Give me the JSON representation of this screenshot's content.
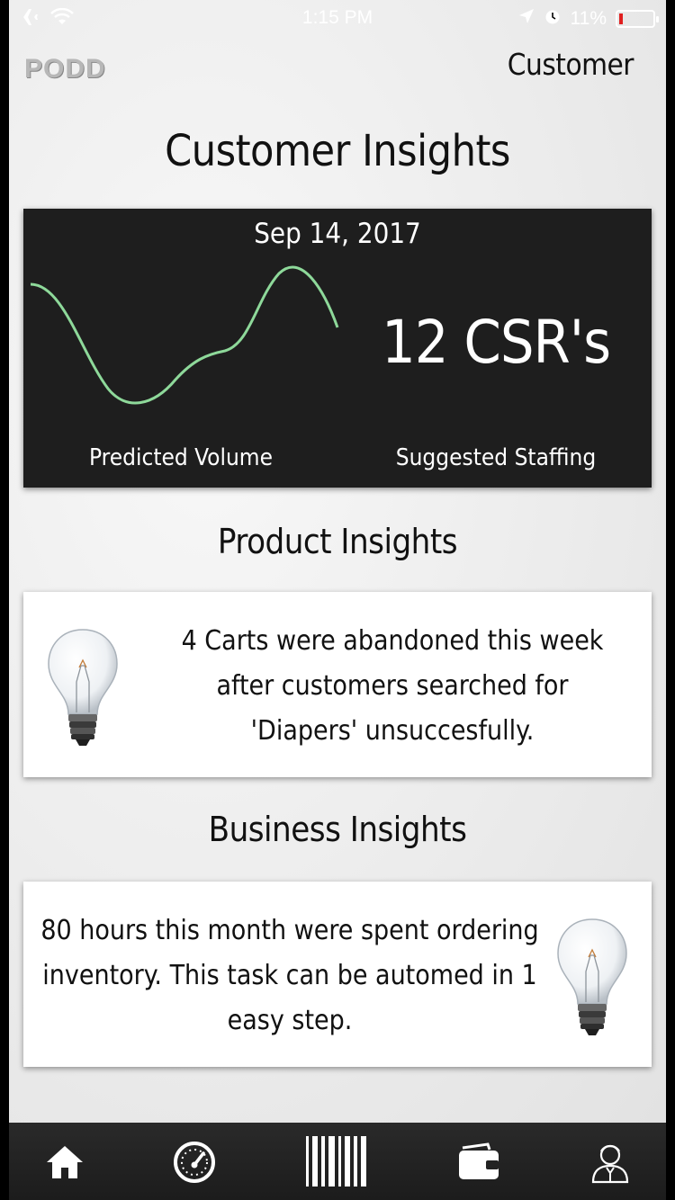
{
  "status_bar": {
    "time": "1:15 PM",
    "battery_percent": "11%",
    "battery_level": 0.11,
    "icons": [
      "airplane-icon",
      "wifi-icon",
      "location-icon",
      "alarm-icon",
      "battery-icon"
    ]
  },
  "header": {
    "logo": "PODD",
    "nav_link": "Customer"
  },
  "customer_insights": {
    "title": "Customer Insights",
    "date": "Sep 14, 2017",
    "staffing_value": "12 CSR's",
    "volume_label": "Predicted Volume",
    "staffing_label": "Suggested Staffing",
    "line_color": "#8ed99a"
  },
  "product_insights": {
    "title": "Product Insights",
    "text": "4 Carts were abandoned this week after customers searched for 'Diapers' unsuccesfully.",
    "icon": "lightbulb-icon"
  },
  "business_insights": {
    "title": "Business Insights",
    "text": "80 hours this month were spent ordering inventory. This task can be automed in 1 easy step.",
    "icon": "lightbulb-icon"
  },
  "tab_bar": {
    "tabs": [
      "home-icon",
      "speedometer-icon",
      "barcode-icon",
      "wallet-icon",
      "user-icon"
    ]
  }
}
